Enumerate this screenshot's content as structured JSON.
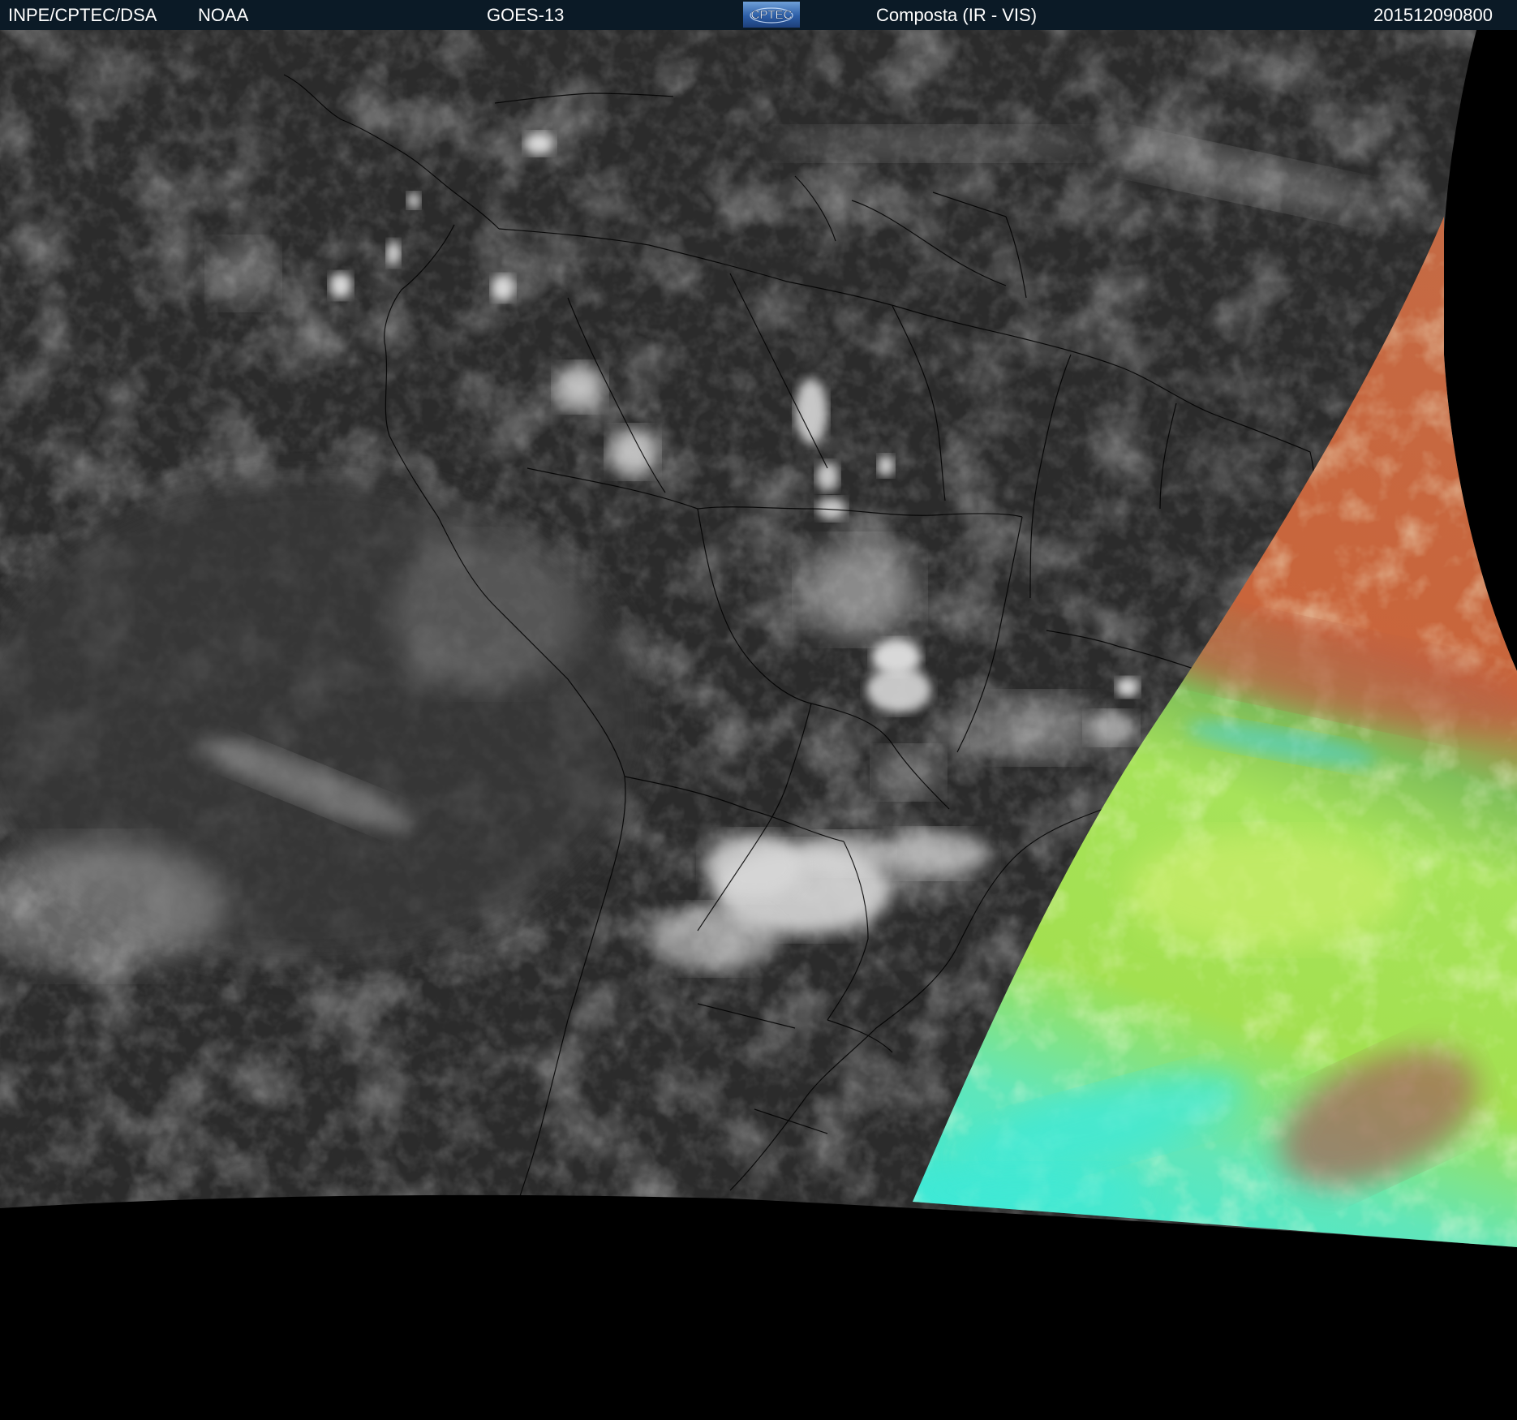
{
  "header": {
    "organization": "INPE/CPTEC/DSA",
    "agency": "NOAA",
    "satellite": "GOES-13",
    "logo_text": "CPTEC",
    "product": "Composta (IR - VIS)",
    "timestamp": "201512090800"
  },
  "colors": {
    "header_bg": "#0b1a26",
    "ir_background": "#2b2b2b",
    "cloud": "#d8d8d8",
    "coastline": "#000000",
    "vis_orange": "#c9653b",
    "vis_green": "#a7e35a",
    "vis_cyan": "#3fe9d6",
    "space": "#000000"
  }
}
